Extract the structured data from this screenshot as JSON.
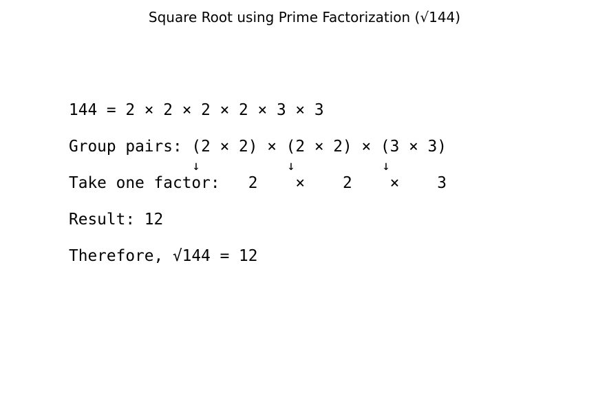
{
  "title": "Square Root using Prime Factorization (√144)",
  "steps": {
    "factorization": "144 = 2 × 2 × 2 × 2 × 3 × 3",
    "group_pairs": "Group pairs: (2 × 2) × (2 × 2) × (3 × 3)",
    "arrows": [
      "↓",
      "↓",
      "↓"
    ],
    "take_one": "Take one factor:   2    ×    2    ×    3",
    "result": "Result: 12",
    "conclusion": "Therefore, √144 = 12"
  }
}
